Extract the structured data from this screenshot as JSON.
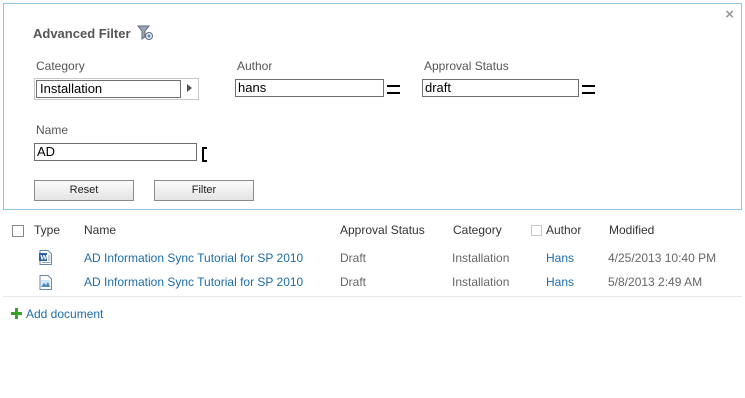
{
  "filter_panel": {
    "title": "Advanced Filter",
    "close_glyph": "×",
    "category": {
      "label": "Category",
      "value": "Installation"
    },
    "author": {
      "label": "Author",
      "value": "hans"
    },
    "approval_status": {
      "label": "Approval Status",
      "value": "draft"
    },
    "name": {
      "label": "Name",
      "value": "AD"
    },
    "reset_label": "Reset",
    "filter_label": "Filter"
  },
  "list": {
    "headers": {
      "type": "Type",
      "name": "Name",
      "approval_status": "Approval Status",
      "category": "Category",
      "author": "Author",
      "modified": "Modified"
    },
    "rows": [
      {
        "icon": "word-document-icon",
        "name": "AD Information Sync Tutorial for SP 2010",
        "approval_status": "Draft",
        "category": "Installation",
        "author": "Hans",
        "modified": "4/25/2013 10:40 PM"
      },
      {
        "icon": "image-document-icon",
        "name": "AD Information Sync Tutorial for SP 2010",
        "approval_status": "Draft",
        "category": "Installation",
        "author": "Hans",
        "modified": "5/8/2013 2:49 AM"
      }
    ],
    "add_document_label": "Add document"
  },
  "colors": {
    "link": "#1e6ca8",
    "panel_border": "#8fc4e3",
    "add_icon": "#3aa02a"
  }
}
